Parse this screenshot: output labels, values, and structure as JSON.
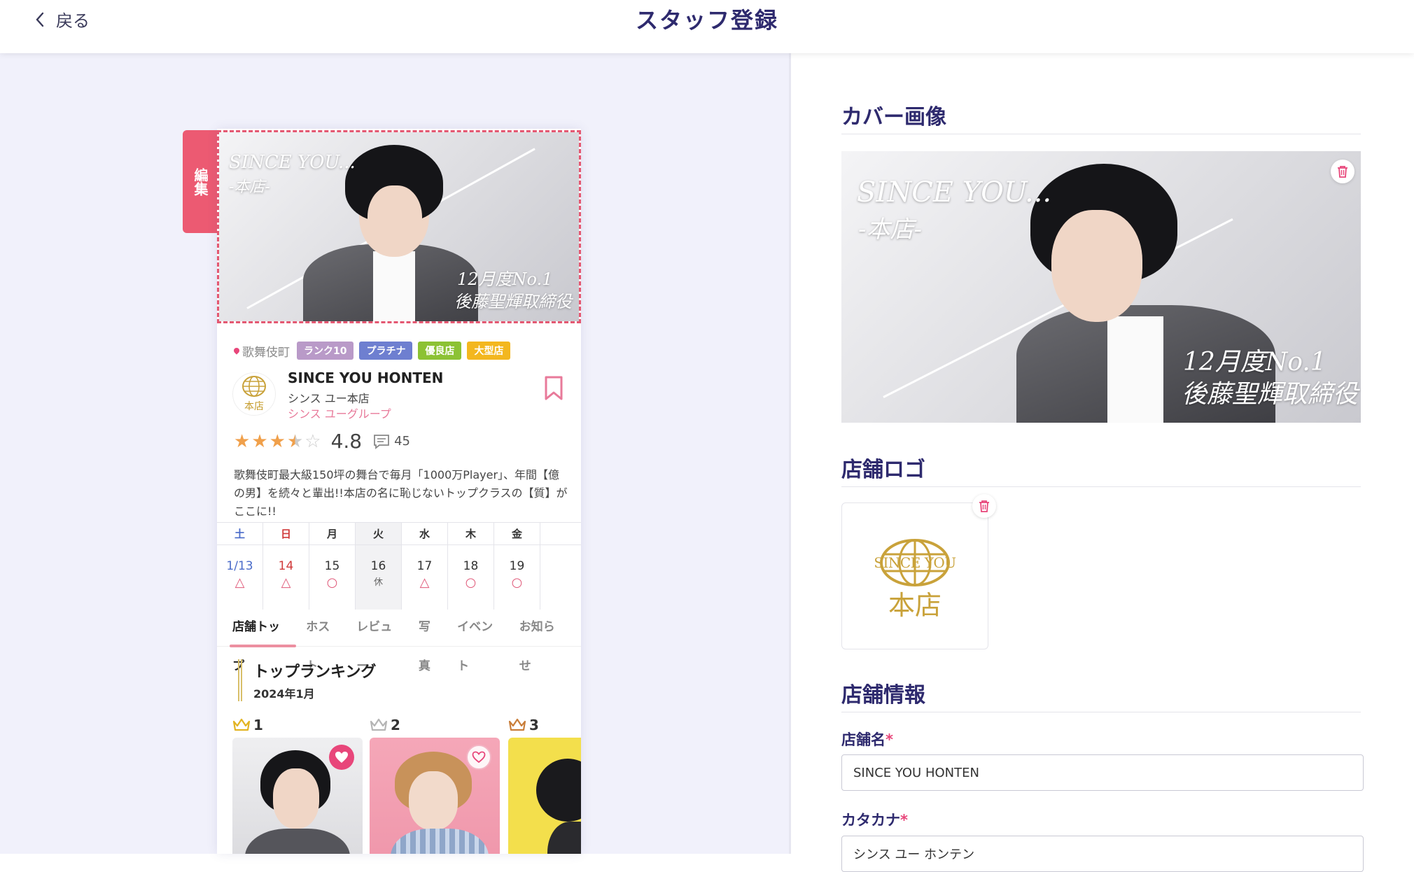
{
  "header": {
    "back_label": "戻る",
    "title": "スタッフ登録"
  },
  "preview": {
    "edit_label": "編集",
    "cover": {
      "line1": "SINCE YOU...",
      "line2": "-本店-",
      "line3": "12月度No.1",
      "line4": "後藤聖輝取締役"
    },
    "location": "歌舞伎町",
    "badges": [
      {
        "label": "ランク10",
        "color": "#b99ac8"
      },
      {
        "label": "プラチナ",
        "color": "#6e7fd0"
      },
      {
        "label": "優良店",
        "color": "#8cc234"
      },
      {
        "label": "大型店",
        "color": "#f3b71f"
      }
    ],
    "shop_name": "SINCE YOU HONTEN",
    "shop_kana": "シンス ユー本店",
    "shop_group": "シンス ユーグループ",
    "rating_value": "4.8",
    "rating_stars": 3.5,
    "review_count": "45",
    "description": "歌舞伎町最大級150坪の舞台で毎月「1000万Player」、年間【億の男】を続々と輩出!!本店の名に恥じないトップクラスの【質】がここに!!",
    "calendar": {
      "days": [
        "土",
        "日",
        "月",
        "火",
        "水",
        "木",
        "金"
      ],
      "day_colors": [
        "#4a6bc9",
        "#d03a3a",
        "#333",
        "#333",
        "#333",
        "#333",
        "#333"
      ],
      "dates": [
        "1/13",
        "14",
        "15",
        "16",
        "17",
        "18",
        "19"
      ],
      "date_colors": [
        "#4a6bc9",
        "#d03a3a",
        "#333",
        "#333",
        "#333",
        "#333",
        "#333"
      ],
      "marks": [
        "△",
        "△",
        "○",
        "休",
        "△",
        "○",
        "○"
      ]
    },
    "tabs": [
      "店舗トップ",
      "ホスト",
      "レビュー",
      "写真",
      "イベント",
      "お知らせ"
    ],
    "ranking": {
      "title": "トップランキング",
      "month": "2024年1月",
      "items": [
        {
          "rank": "1",
          "crown_color": "#e2b423"
        },
        {
          "rank": "2",
          "crown_color": "#b5b5b5"
        },
        {
          "rank": "3",
          "crown_color": "#c97e3a"
        }
      ]
    }
  },
  "form": {
    "cover_title": "カバー画像",
    "cover_text": {
      "line1": "SINCE YOU...",
      "line2": "-本店-",
      "line3": "12月度No.1",
      "line4": "後藤聖輝取締役"
    },
    "logo_title": "店舗ロゴ",
    "logo_text": {
      "since": "SINCE YOU",
      "honten": "本店"
    },
    "info_title": "店舗情報",
    "shop_name_label": "店舗名",
    "shop_name_value": "SINCE YOU HONTEN",
    "kana_label": "カタカナ",
    "kana_value": "シンス ユー ホンテン",
    "required_mark": "*"
  }
}
